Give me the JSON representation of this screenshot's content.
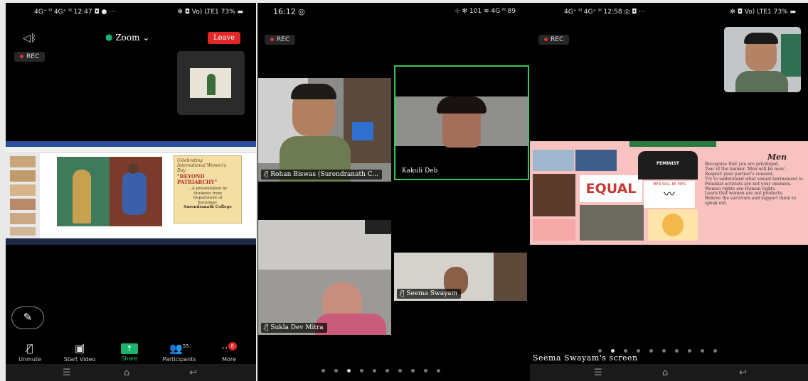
{
  "panel1": {
    "status_left": "4G⁺ ᴵˡˡ 4G⁺ ᴵˡˡ 12:47 ◘ ● ···",
    "status_right": "✻ ◘ Vo) LTE1 73% ▬",
    "meeting_name": "Zoom",
    "leave_label": "Leave",
    "rec_label": "REC",
    "slide": {
      "title_lines": [
        "Celebrating",
        "International Women's",
        "Day"
      ],
      "headline": "\"BEYOND PATRIARCHY\"",
      "sub_lines": [
        "...A presentation by",
        "Students from",
        "Department of",
        "Sociology,",
        "Surendranath College"
      ]
    },
    "controls": [
      {
        "label": "Unmute",
        "icon": "mic-off-icon"
      },
      {
        "label": "Start Video",
        "icon": "video-off-icon"
      },
      {
        "label": "Share",
        "icon": "share-icon"
      },
      {
        "label": "Participants",
        "icon": "participants-icon",
        "count": "55"
      },
      {
        "label": "More",
        "icon": "more-icon",
        "badge": "8"
      }
    ]
  },
  "panel2": {
    "status_time": "16:12",
    "status_right": "⊹ ✻ 101 ≋ 4G ᴵˡˡ 89",
    "rec_label": "REC",
    "participants": [
      {
        "name": "Rohan Biswas (Surendranath C..."
      },
      {
        "name": "Kakuli Deb"
      },
      {
        "name": "Sukla Dev Mitra"
      },
      {
        "name": "Seema Swayam"
      }
    ]
  },
  "panel3": {
    "status_left": "4G⁺ ᴵˡˡ 4G⁺ ᴵˡˡ 12:58 ◎ ◘ ···",
    "status_right": "✻ ◘ Vo) LTE1 73% ▬",
    "rec_label": "REC",
    "slide": {
      "heading": "Men",
      "bullets": [
        "Recognise that you are privileged.",
        "Tear of the banner-'Men will be men'.",
        "Respect your partner's consent.",
        "Try to understand what sexual harrasment is.",
        "Feminist activists are not your enemies.",
        "Women rights are Human rights.",
        "Learn that women are not products.",
        "Believe the survivors and support them to speak out."
      ],
      "equal_text": "EQUAL",
      "shirt_text": "FEMINIST",
      "men_text": "MEN WILL BE MEN"
    },
    "screen_label": "Seema Swayam's screen"
  }
}
